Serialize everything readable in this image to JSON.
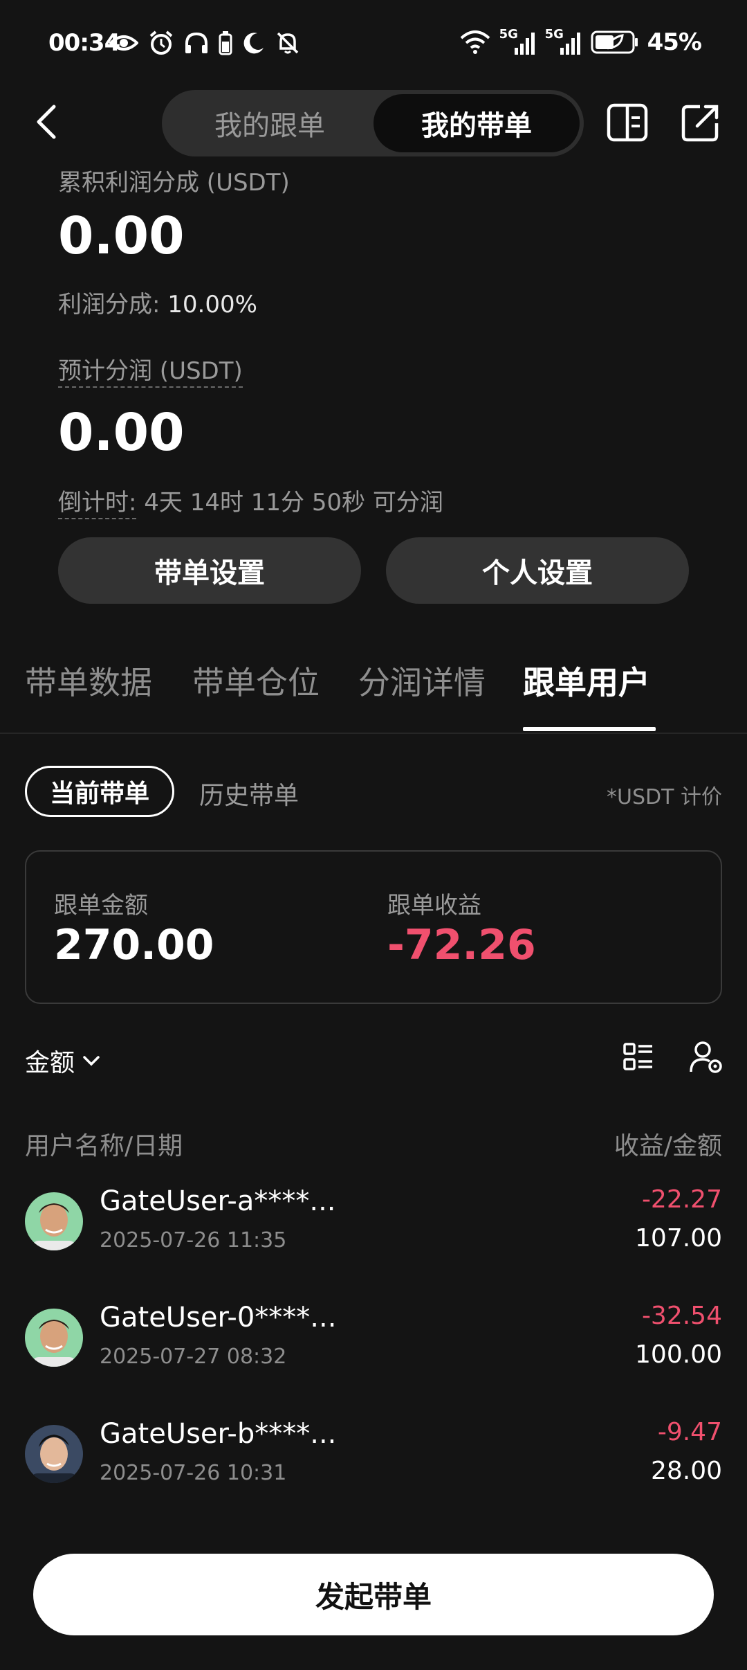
{
  "status_bar": {
    "time": "00:34",
    "network_1": "5G",
    "network_2": "5G",
    "battery": "45%"
  },
  "header": {
    "seg_following": "我的跟单",
    "seg_leading": "我的带单"
  },
  "stats": {
    "cum_profit_label": "累积利润分成 (USDT)",
    "cum_profit_value": "0.00",
    "profit_share_label": "利润分成:",
    "profit_share_value": "10.00%",
    "expected_label": "预计分润 (USDT)",
    "expected_value": "0.00",
    "countdown_label": "倒计时:",
    "countdown_value": "4天 14时 11分 50秒 可分润"
  },
  "actions": {
    "lead_settings": "带单设置",
    "personal_settings": "个人设置"
  },
  "tabs": [
    "带单数据",
    "带单仓位",
    "分润详情",
    "跟单用户"
  ],
  "subtabs": {
    "current": "当前带单",
    "history": "历史带单",
    "price_note": "*USDT 计价"
  },
  "summary": {
    "amount_label": "跟单金额",
    "amount_value": "270.00",
    "pnl_label": "跟单收益",
    "pnl_value": "-72.26"
  },
  "list": {
    "sort_label": "金额",
    "col_left": "用户名称/日期",
    "col_right": "收益/金额",
    "rows": [
      {
        "name": "GateUser-a****...",
        "date": "2025-07-26 11:35",
        "pnl": "-22.27",
        "amount": "107.00"
      },
      {
        "name": "GateUser-0****...",
        "date": "2025-07-27 08:32",
        "pnl": "-32.54",
        "amount": "100.00"
      },
      {
        "name": "GateUser-b****...",
        "date": "2025-07-26 10:31",
        "pnl": "-9.47",
        "amount": "28.00"
      }
    ]
  },
  "cta": "发起带单",
  "colors": {
    "negative": "#f0506e",
    "background": "#141414"
  }
}
